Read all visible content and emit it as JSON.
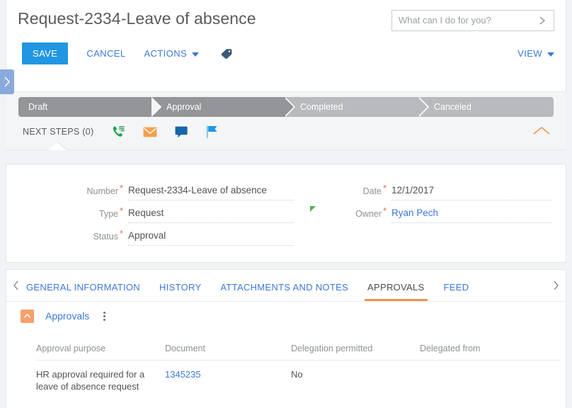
{
  "header": {
    "title": "Request-2334-Leave of absence",
    "search": {
      "placeholder": "What can I do for you?",
      "value": "",
      "go_icon": "chevron-right-icon"
    },
    "toolbar": {
      "save_label": "SAVE",
      "cancel_label": "CANCEL",
      "actions_label": "ACTIONS",
      "tag_icon": "tag-icon"
    },
    "view_menu_label": "VIEW",
    "left_panel_handle_icon": "chevron-right-icon"
  },
  "stages": [
    {
      "label": "Draft",
      "state": "active"
    },
    {
      "label": "Approval",
      "state": "active"
    },
    {
      "label": "Completed",
      "state": "inactive"
    },
    {
      "label": "Canceled",
      "state": "inactive"
    }
  ],
  "next_steps": {
    "label": "NEXT STEPS (0)",
    "count": 0,
    "icons": [
      {
        "name": "phone-call-icon",
        "color": "#17a44a"
      },
      {
        "name": "email-envelope-icon",
        "color": "#f5a14e"
      },
      {
        "name": "chat-bubble-icon",
        "color": "#1565a8"
      },
      {
        "name": "flag-icon",
        "color": "#49a5e6"
      }
    ],
    "collapse_icon": "chevron-up-icon"
  },
  "form": {
    "left_fields": [
      {
        "label": "Number",
        "value": "Request-2334-Leave of absence",
        "required": true,
        "link": false
      },
      {
        "label": "Type",
        "value": "Request",
        "required": true,
        "link": false
      },
      {
        "label": "Status",
        "value": "Approval",
        "required": true,
        "link": false
      }
    ],
    "right_fields": [
      {
        "label": "Date",
        "value": "12/1/2017",
        "required": true,
        "link": false,
        "marker": false
      },
      {
        "label": "Owner",
        "value": "Ryan Pech",
        "required": true,
        "link": true,
        "marker": true
      }
    ]
  },
  "tabs": {
    "prev_icon": "chevron-left-icon",
    "next_icon": "chevron-right-icon",
    "items": [
      {
        "label": "GENERAL INFORMATION",
        "active": false
      },
      {
        "label": "HISTORY",
        "active": false
      },
      {
        "label": "ATTACHMENTS AND NOTES",
        "active": false
      },
      {
        "label": "APPROVALS",
        "active": true
      },
      {
        "label": "FEED",
        "active": false
      }
    ]
  },
  "approvals_section": {
    "collapse_icon": "chevron-up-icon",
    "title": "Approvals",
    "menu_icon": "kebab-menu-icon",
    "table": {
      "columns": [
        "Approval purpose",
        "Document",
        "Delegation permitted",
        "Delegated from"
      ],
      "rows": [
        {
          "purpose": "HR approval required for a leave of absence request",
          "document": "1345235",
          "delegation_permitted": "No",
          "delegated_from": ""
        }
      ]
    }
  },
  "colors": {
    "accent_blue": "#2196e3",
    "link_blue": "#3b78d8",
    "orange": "#f0944c",
    "stage_active": "#939598",
    "stage_inactive": "#b8babd",
    "page_bg": "#f1f3f6"
  }
}
